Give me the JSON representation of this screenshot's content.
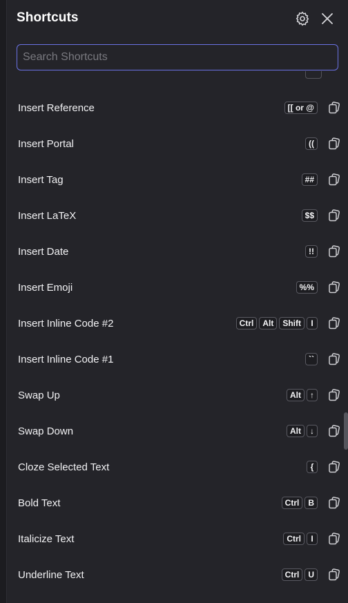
{
  "header": {
    "title": "Shortcuts",
    "icons": [
      "gear-icon",
      "close-icon"
    ]
  },
  "search": {
    "placeholder": "Search Shortcuts",
    "value": ""
  },
  "shortcuts": [
    {
      "label": "Insert Reference",
      "keys": [
        "[[ or @"
      ]
    },
    {
      "label": "Insert Portal",
      "keys": [
        "(("
      ]
    },
    {
      "label": "Insert Tag",
      "keys": [
        "##"
      ]
    },
    {
      "label": "Insert LaTeX",
      "keys": [
        "$$"
      ]
    },
    {
      "label": "Insert Date",
      "keys": [
        "!!"
      ]
    },
    {
      "label": "Insert Emoji",
      "keys": [
        "%%"
      ]
    },
    {
      "label": "Insert Inline Code #2",
      "keys": [
        "Ctrl",
        "Alt",
        "Shift",
        "I"
      ]
    },
    {
      "label": "Insert Inline Code #1",
      "keys": [
        "``"
      ]
    },
    {
      "label": "Swap Up",
      "keys": [
        "Alt",
        "↑"
      ]
    },
    {
      "label": "Swap Down",
      "keys": [
        "Alt",
        "↓"
      ]
    },
    {
      "label": "Cloze Selected Text",
      "keys": [
        "{"
      ]
    },
    {
      "label": "Bold Text",
      "keys": [
        "Ctrl",
        "B"
      ]
    },
    {
      "label": "Italicize Text",
      "keys": [
        "Ctrl",
        "I"
      ]
    },
    {
      "label": "Underline Text",
      "keys": [
        "Ctrl",
        "U"
      ]
    }
  ],
  "colors": {
    "background": "#242429",
    "accent": "#6b73e6",
    "text": "#f2f2f4"
  }
}
